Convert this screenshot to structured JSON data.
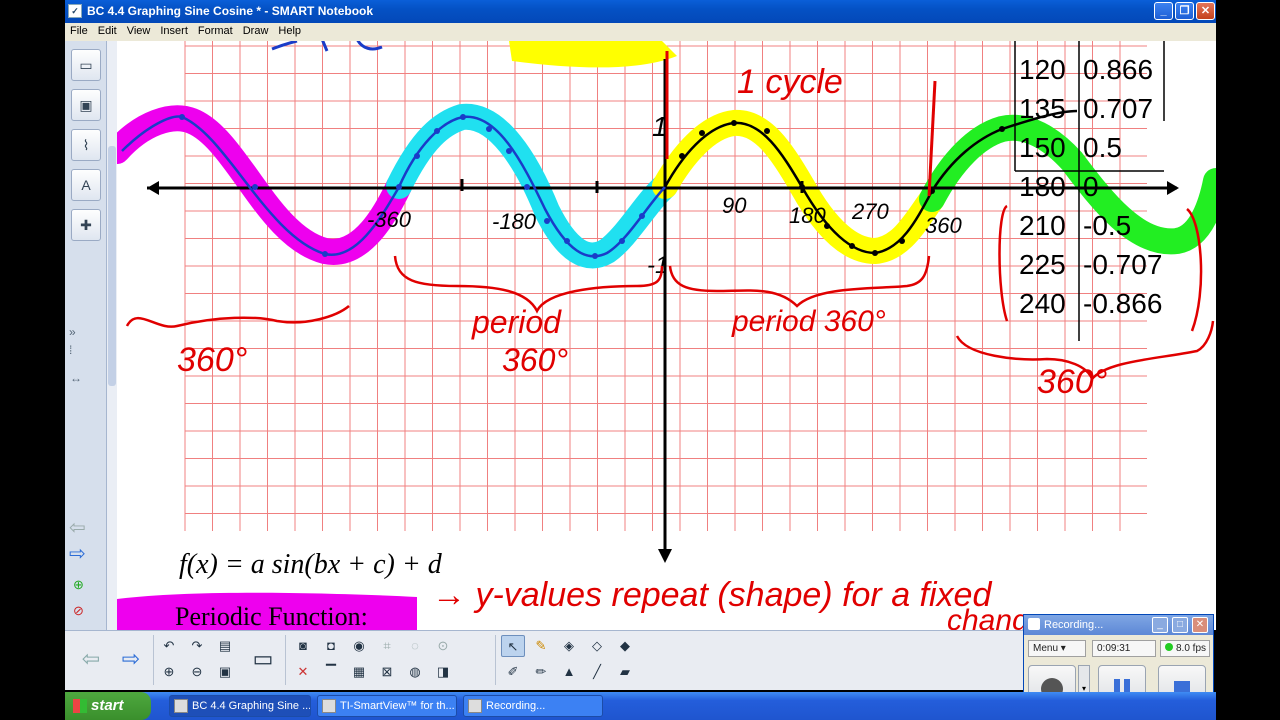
{
  "window": {
    "title": "BC 4.4 Graphing Sine Cosine * - SMART Notebook",
    "minimize": "_",
    "restore": "❐",
    "close": "✕"
  },
  "menu": [
    "File",
    "Edit",
    "View",
    "Insert",
    "Format",
    "Draw",
    "Help"
  ],
  "canvas": {
    "formula": "f(x) = a sin(bx + c) + d",
    "periodic_label": "Periodic Function:",
    "handwriting": {
      "cycle": "1 cycle",
      "one_top": "1",
      "neg_one": "-1",
      "x_ticks": [
        "-360",
        "-180",
        "90",
        "180",
        "270",
        "360"
      ],
      "period_left": "period",
      "period_left_deg": "360°",
      "period_right": "period 360°",
      "left_360": "360°",
      "right_360": "360°",
      "definition": "→ y-values repeat (shape) for a fixed",
      "definition_2": "change"
    },
    "table": [
      [
        "120",
        "0.866"
      ],
      [
        "135",
        "0.707"
      ],
      [
        "150",
        "0.5"
      ],
      [
        "180",
        "0"
      ],
      [
        "210",
        "-0.5"
      ],
      [
        "225",
        "-0.707"
      ],
      [
        "240",
        "-0.866"
      ]
    ],
    "colors": {
      "magenta": "#ee00ee",
      "cyan": "#20e0f0",
      "yellow": "#ffff00",
      "green": "#22ee22",
      "red_ink": "#e00000",
      "blue_ink": "#1a3cc8",
      "grid": "#f08080"
    }
  },
  "recording": {
    "title": "Recording...",
    "menu": "Menu",
    "time": "0:09:31",
    "fps": "8.0 fps"
  },
  "taskbar": {
    "start": "start",
    "items": [
      "BC 4.4 Graphing Sine ...",
      "TI-SmartView™ for th...",
      "Recording..."
    ]
  }
}
